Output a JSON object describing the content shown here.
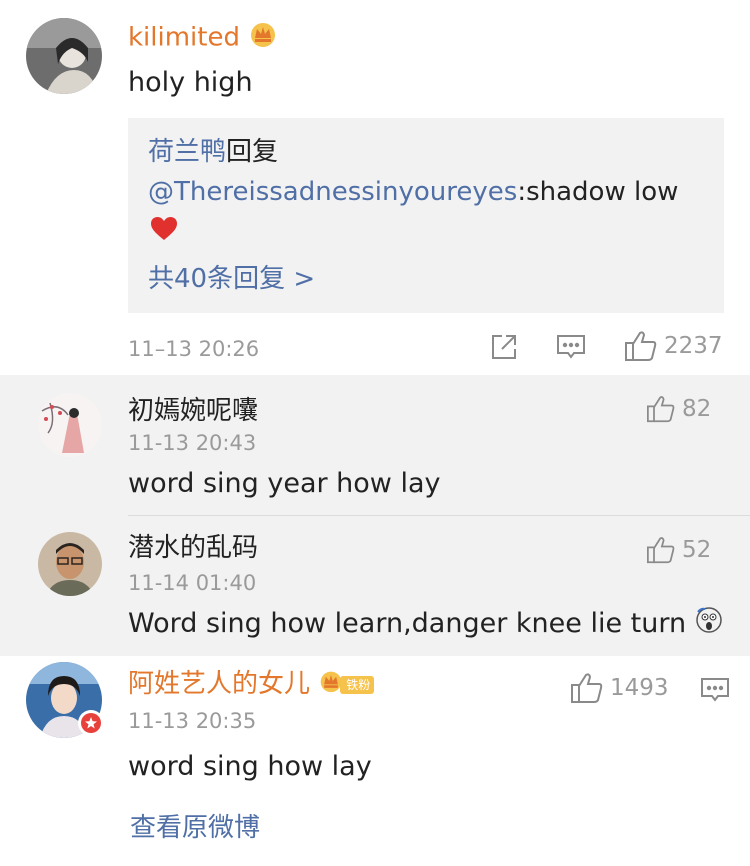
{
  "comments": [
    {
      "username": "kilimited",
      "text": "holy high",
      "reply": {
        "author": "荷兰鸭",
        "reply_word": "回复",
        "mention": "@Thereissadnessinyoureyes",
        "text": ":shadow low",
        "more": "共40条回复 >"
      },
      "time": "11–13 20:26",
      "likes": "2237"
    }
  ],
  "sub_comments": [
    {
      "username": "初嫣婉呢囔",
      "time": "11-13 20:43",
      "text": "word sing year how lay",
      "likes": "82"
    },
    {
      "username": "潜水的乱码",
      "time": "11-14 01:40",
      "text": "Word sing how learn,danger knee lie turn",
      "likes": "52"
    }
  ],
  "comment2": {
    "username": "阿姓艺人的女儿",
    "badge": "铁粉",
    "time": "11-13 20:35",
    "text": "word sing how lay",
    "likes": "1493"
  },
  "footer": {
    "view_original": "查看原微博"
  },
  "colors": {
    "orange": "#e3772b",
    "link": "#4f6fa6",
    "gray": "#9a9a9a",
    "panel": "#f2f2f2"
  }
}
